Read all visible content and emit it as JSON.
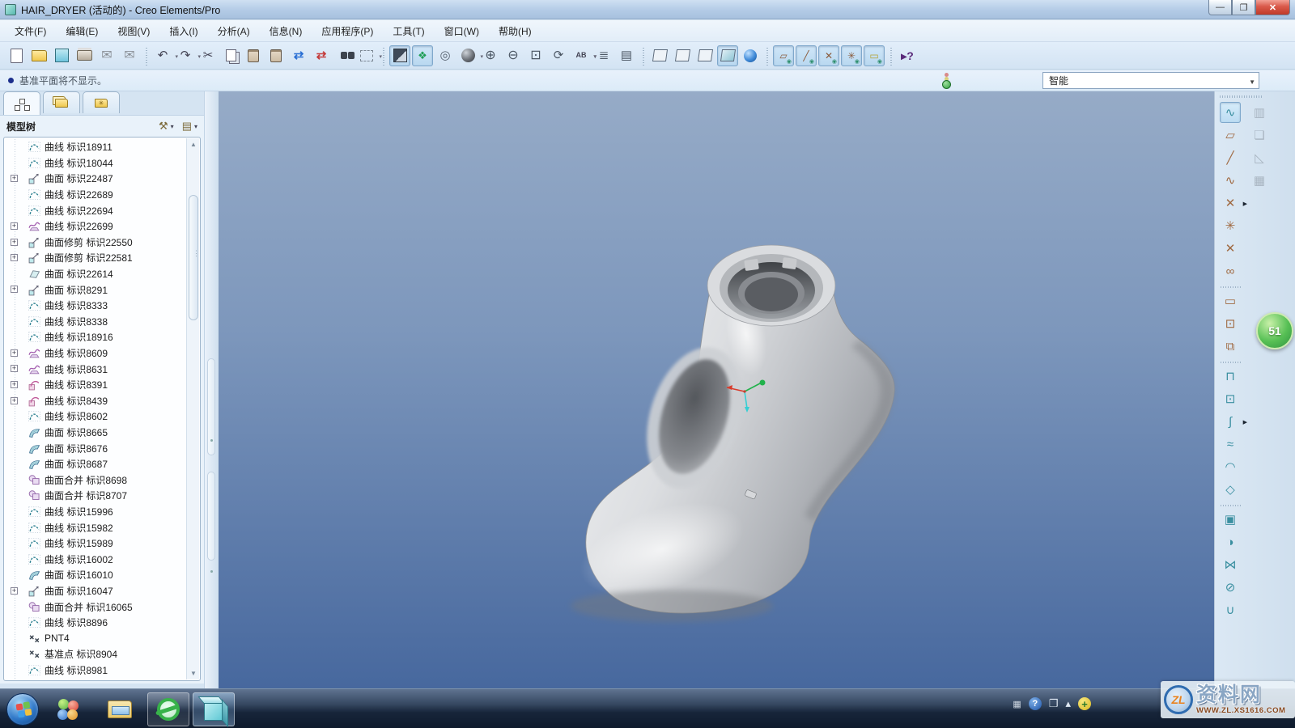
{
  "window": {
    "title": "HAIR_DRYER (活动的) - Creo Elements/Pro"
  },
  "menu": {
    "items": [
      {
        "dn": "menu-file",
        "label": "文件(F)"
      },
      {
        "dn": "menu-edit",
        "label": "编辑(E)"
      },
      {
        "dn": "menu-view",
        "label": "视图(V)"
      },
      {
        "dn": "menu-insert",
        "label": "插入(I)"
      },
      {
        "dn": "menu-analysis",
        "label": "分析(A)"
      },
      {
        "dn": "menu-info",
        "label": "信息(N)"
      },
      {
        "dn": "menu-applications",
        "label": "应用程序(P)"
      },
      {
        "dn": "menu-tools",
        "label": "工具(T)"
      },
      {
        "dn": "menu-window",
        "label": "窗口(W)"
      },
      {
        "dn": "menu-help",
        "label": "帮助(H)"
      }
    ]
  },
  "toolbar": {
    "items": [
      {
        "name": "new-file-button",
        "kind": "page",
        "g": ""
      },
      {
        "name": "open-file-button",
        "kind": "folder",
        "g": ""
      },
      {
        "name": "save-button",
        "kind": "disk",
        "g": ""
      },
      {
        "name": "print-button",
        "kind": "printer",
        "g": ""
      },
      {
        "name": "email-button",
        "kind": "mail",
        "g": "✉"
      },
      {
        "name": "email-link-button",
        "kind": "mail",
        "g": "✉"
      },
      {
        "name": "toolbar-separator",
        "kind": "sep",
        "g": ""
      },
      {
        "name": "undo-button",
        "kind": "glyph",
        "g": "↶",
        "dd": true
      },
      {
        "name": "redo-button",
        "kind": "glyph",
        "g": "↷",
        "dd": true
      },
      {
        "name": "cut-button",
        "kind": "glyph",
        "g": "✂"
      },
      {
        "name": "copy-button",
        "kind": "copyic",
        "g": ""
      },
      {
        "name": "paste-button",
        "kind": "pasteic",
        "g": ""
      },
      {
        "name": "paste-special-button",
        "kind": "pasteic",
        "g": ""
      },
      {
        "name": "regenerate-button",
        "kind": "regen1",
        "g": "⇄"
      },
      {
        "name": "regenerate-manager-button",
        "kind": "regen2",
        "g": "⇄"
      },
      {
        "name": "find-button",
        "kind": "binoc",
        "g": ""
      },
      {
        "name": "select-rect-button",
        "kind": "selbox",
        "g": "",
        "dd": true
      },
      {
        "name": "toolbar-separator",
        "kind": "sep",
        "g": ""
      },
      {
        "name": "orient-mode-button",
        "kind": "orient",
        "g": "",
        "on": true
      },
      {
        "name": "spin-center-button",
        "kind": "spin",
        "g": "❖",
        "on": true
      },
      {
        "name": "view-setup-button",
        "kind": "vsetup",
        "g": "◎"
      },
      {
        "name": "appearance-gallery-button",
        "kind": "sphere",
        "g": "",
        "dd": true
      },
      {
        "name": "zoom-in-button",
        "kind": "zin",
        "g": "⊕"
      },
      {
        "name": "zoom-out-button",
        "kind": "zout",
        "g": "⊖"
      },
      {
        "name": "zoom-refit-button",
        "kind": "zfit",
        "g": "⊡"
      },
      {
        "name": "repaint-button",
        "kind": "repaint",
        "g": "⟳"
      },
      {
        "name": "saved-views-button",
        "kind": "views",
        "g": "AB",
        "dd": true
      },
      {
        "name": "layers-button",
        "kind": "layers",
        "g": "≣"
      },
      {
        "name": "view-manager-button",
        "kind": "vmgr",
        "g": "▤"
      },
      {
        "name": "toolbar-separator",
        "kind": "sep",
        "g": ""
      },
      {
        "name": "wireframe-display-button",
        "kind": "cube cw",
        "g": ""
      },
      {
        "name": "hidden-line-display-button",
        "kind": "cube chl",
        "g": ""
      },
      {
        "name": "no-hidden-display-button",
        "kind": "cube cnh",
        "g": ""
      },
      {
        "name": "shaded-display-button",
        "kind": "cube csh",
        "g": "",
        "on": true
      },
      {
        "name": "enhanced-realism-button",
        "kind": "ball",
        "g": ""
      },
      {
        "name": "toolbar-separator",
        "kind": "sep",
        "g": ""
      },
      {
        "name": "datum-plane-toggle",
        "kind": "tgl",
        "g": "▱",
        "on": true
      },
      {
        "name": "datum-axis-toggle",
        "kind": "tgl",
        "g": "╱",
        "on": true
      },
      {
        "name": "datum-point-toggle",
        "kind": "tgl",
        "g": "✕",
        "on": true
      },
      {
        "name": "csys-toggle",
        "kind": "tgl",
        "g": "✳",
        "on": true
      },
      {
        "name": "annotation-toggle",
        "kind": "tgl tann",
        "g": "▭",
        "on": true
      },
      {
        "name": "toolbar-separator",
        "kind": "sep",
        "g": ""
      },
      {
        "name": "context-help-button",
        "kind": "helpb",
        "g": "▸?"
      }
    ]
  },
  "message_bar": {
    "text": "基准平面将不显示。",
    "filter_value": "智能"
  },
  "navigator": {
    "title": "模型树",
    "tabs": [
      {
        "name": "model-tree-tab"
      },
      {
        "name": "folder-browser-tab"
      },
      {
        "name": "favorites-tab"
      }
    ],
    "items": [
      {
        "icon": "#i-c",
        "label": "曲线 标识18911"
      },
      {
        "icon": "#i-c",
        "label": "曲线 标识18044"
      },
      {
        "icon": "#i-s",
        "label": "曲面 标识22487",
        "exp": true
      },
      {
        "icon": "#i-c",
        "label": "曲线 标识22689"
      },
      {
        "icon": "#i-c",
        "label": "曲线 标识22694"
      },
      {
        "icon": "#i-p",
        "label": "曲线 标识22699",
        "exp": true
      },
      {
        "icon": "#i-s",
        "label": "曲面修剪 标识22550",
        "exp": true
      },
      {
        "icon": "#i-s",
        "label": "曲面修剪 标识22581",
        "exp": true
      },
      {
        "icon": "#i-f",
        "label": "曲面 标识22614"
      },
      {
        "icon": "#i-s",
        "label": "曲面 标识8291",
        "exp": true
      },
      {
        "icon": "#i-c",
        "label": "曲线 标识8333"
      },
      {
        "icon": "#i-c",
        "label": "曲线 标识8338"
      },
      {
        "icon": "#i-c",
        "label": "曲线 标识18916"
      },
      {
        "icon": "#i-p",
        "label": "曲线 标识8609",
        "exp": true
      },
      {
        "icon": "#i-p",
        "label": "曲线 标识8631",
        "exp": true
      },
      {
        "icon": "#i-k",
        "label": "曲线 标识8391",
        "exp": true
      },
      {
        "icon": "#i-k",
        "label": "曲线 标识8439",
        "exp": true
      },
      {
        "icon": "#i-c",
        "label": "曲线 标识8602"
      },
      {
        "icon": "#i-b",
        "label": "曲面 标识8665"
      },
      {
        "icon": "#i-b",
        "label": "曲面 标识8676"
      },
      {
        "icon": "#i-b",
        "label": "曲面 标识8687"
      },
      {
        "icon": "#i-m",
        "label": "曲面合并 标识8698"
      },
      {
        "icon": "#i-m",
        "label": "曲面合并 标识8707"
      },
      {
        "icon": "#i-c",
        "label": "曲线 标识15996"
      },
      {
        "icon": "#i-c",
        "label": "曲线 标识15982"
      },
      {
        "icon": "#i-c",
        "label": "曲线 标识15989"
      },
      {
        "icon": "#i-c",
        "label": "曲线 标识16002"
      },
      {
        "icon": "#i-b",
        "label": "曲面 标识16010"
      },
      {
        "icon": "#i-s",
        "label": "曲面 标识16047",
        "exp": true
      },
      {
        "icon": "#i-m",
        "label": "曲面合并 标识16065"
      },
      {
        "icon": "#i-c",
        "label": "曲线 标识8896"
      },
      {
        "icon": "#i-x",
        "label": "PNT4"
      },
      {
        "icon": "#i-x",
        "label": "基准点 标识8904"
      },
      {
        "icon": "#i-c",
        "label": "曲线 标识8981"
      }
    ]
  },
  "right_toolbar": {
    "main": [
      {
        "name": "insert-curve-button",
        "kind": "on",
        "g": "∿"
      },
      {
        "name": "datum-plane-button",
        "kind": "brown",
        "g": "▱"
      },
      {
        "name": "datum-axis-button",
        "kind": "brown",
        "g": "╱"
      },
      {
        "name": "sketched-curve-button",
        "kind": "brown",
        "g": "∿"
      },
      {
        "name": "datum-point-button",
        "kind": "brown",
        "g": "✕",
        "fly": true
      },
      {
        "name": "csys-button",
        "kind": "brown",
        "g": "✳"
      },
      {
        "name": "field-point-button",
        "kind": "brown",
        "g": "✕"
      },
      {
        "name": "copy-geometry-button",
        "kind": "brown",
        "g": "∞"
      },
      {
        "name": "right-toolbar-separator",
        "kind": "sep",
        "g": ""
      },
      {
        "name": "annotation-feature-button",
        "kind": "brown",
        "g": "▭"
      },
      {
        "name": "review-feature-button",
        "kind": "brown",
        "g": "⊡"
      },
      {
        "name": "note-button",
        "kind": "brown",
        "g": "⧉"
      },
      {
        "name": "right-toolbar-separator",
        "kind": "sep",
        "g": ""
      },
      {
        "name": "extrude-button",
        "kind": "",
        "g": "⊓"
      },
      {
        "name": "revolve-button",
        "kind": "",
        "g": "⊡"
      },
      {
        "name": "sweep-button",
        "kind": "",
        "g": "∫",
        "fly": true
      },
      {
        "name": "blend-button",
        "kind": "",
        "g": "≈"
      },
      {
        "name": "boundary-blend-button",
        "kind": "",
        "g": "◠"
      },
      {
        "name": "swept-blend-button",
        "kind": "",
        "g": "◇"
      },
      {
        "name": "right-toolbar-separator",
        "kind": "sep",
        "g": ""
      },
      {
        "name": "copy-surface-button",
        "kind": "",
        "g": "▣"
      },
      {
        "name": "mirror-button",
        "kind": "",
        "g": "◑"
      },
      {
        "name": "merge-button",
        "kind": "",
        "g": "⋈"
      },
      {
        "name": "trim-button",
        "kind": "",
        "g": "⊘"
      },
      {
        "name": "offset-button",
        "kind": "",
        "g": "∪"
      }
    ],
    "secondary": [
      {
        "name": "style-tool-button",
        "kind": "gray",
        "g": "▥"
      },
      {
        "name": "merge-tool-button",
        "kind": "gray",
        "g": "❏"
      },
      {
        "name": "surface-tool-button",
        "kind": "gray",
        "g": "◺"
      },
      {
        "name": "facet-tool-button",
        "kind": "gray",
        "g": "▦"
      }
    ]
  },
  "viewport": {
    "model_name": "hair-dryer-handle"
  },
  "taskbar": {
    "apps": [
      {
        "name": "taskbar-app-quad",
        "kind": ""
      },
      {
        "name": "taskbar-app-explorer",
        "kind": ""
      },
      {
        "name": "taskbar-app-browser",
        "kind": "framed"
      },
      {
        "name": "taskbar-app-creo",
        "kind": "framed active"
      }
    ],
    "tray": [
      {
        "name": "tray-keyboard-icon",
        "kind": "kb",
        "g": "▦"
      },
      {
        "name": "tray-help-icon",
        "kind": "help",
        "g": "?"
      },
      {
        "name": "tray-window-icon",
        "kind": "",
        "g": "❐"
      },
      {
        "name": "tray-show-hidden-icon",
        "kind": "",
        "g": "▴"
      },
      {
        "name": "tray-update-icon",
        "kind": "plus",
        "g": "+"
      }
    ]
  },
  "watermark": {
    "logo_text": "ZL",
    "site_name": "资料网",
    "url": "WWW.ZL.XS1616.COM"
  },
  "overlay_badge": {
    "label": "51"
  }
}
